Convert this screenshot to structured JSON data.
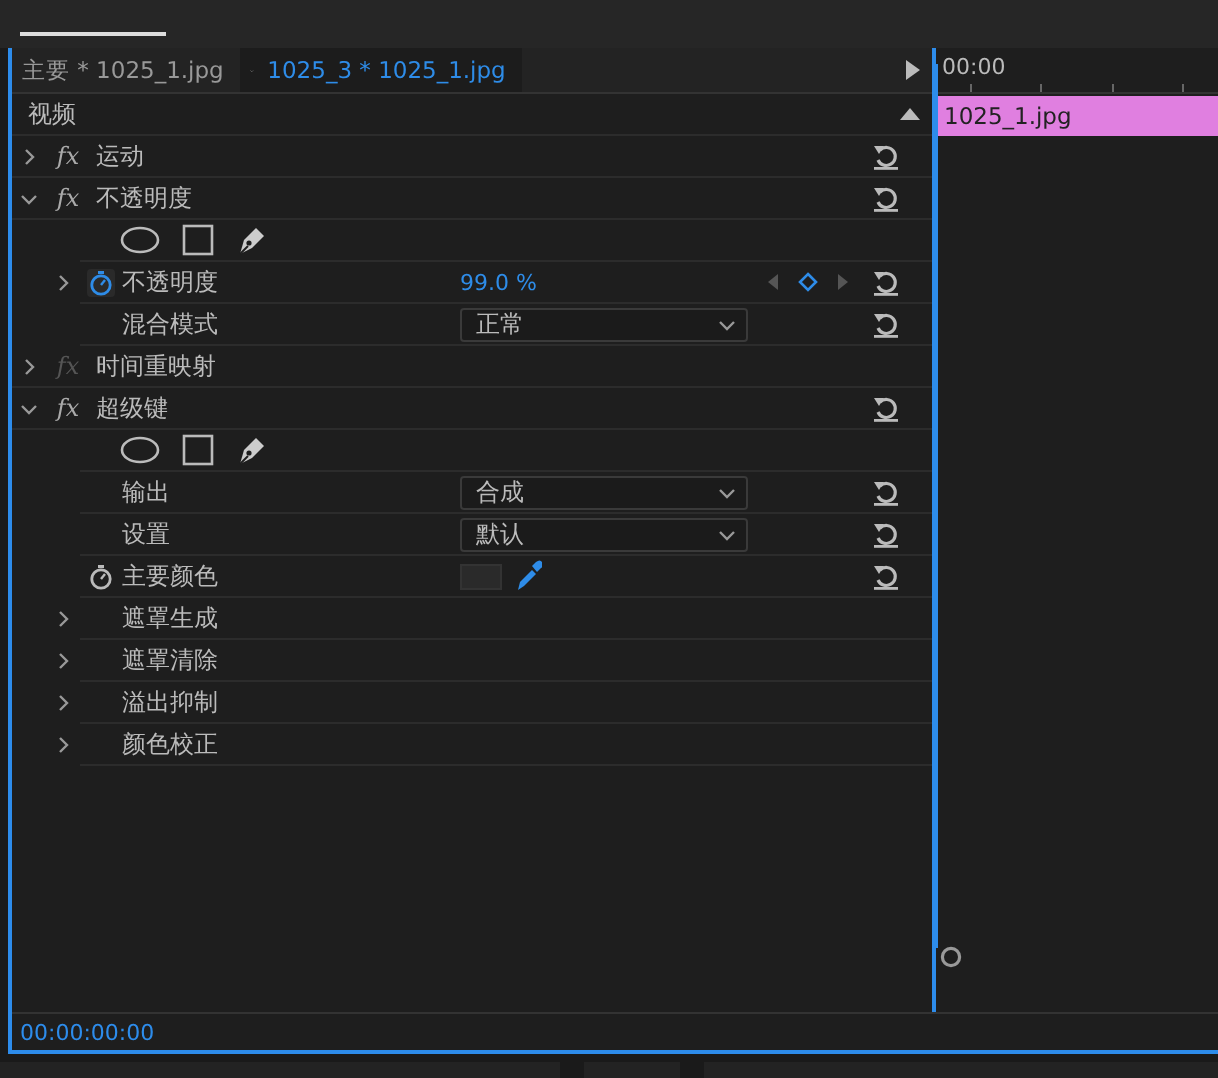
{
  "clip_tabs": [
    {
      "label": "主要 * 1025_1.jpg",
      "selected": false
    },
    {
      "label": "1025_3 * 1025_1.jpg",
      "selected": true
    }
  ],
  "section": {
    "label": "视频",
    "collapsed": false
  },
  "effects": [
    {
      "kind": "effect",
      "badge": "fx",
      "name": "运动",
      "expanded": false,
      "fx_enabled": true,
      "reset": true
    },
    {
      "kind": "effect",
      "badge": "fx",
      "name": "不透明度",
      "expanded": true,
      "fx_enabled": true,
      "reset": true,
      "children": [
        {
          "kind": "mask_tools"
        },
        {
          "kind": "value",
          "name": "不透明度",
          "value": "99.0 %",
          "expandable": true,
          "animated": true,
          "keyframes": true,
          "reset": true
        },
        {
          "kind": "dropdown",
          "name": "混合模式",
          "value": "正常",
          "reset": true
        }
      ]
    },
    {
      "kind": "effect",
      "badge": "fx",
      "name": "时间重映射",
      "expanded": false,
      "fx_enabled": false,
      "reset": false
    },
    {
      "kind": "effect",
      "badge": "fx",
      "name": "超级键",
      "expanded": true,
      "fx_enabled": true,
      "reset": true,
      "children": [
        {
          "kind": "mask_tools"
        },
        {
          "kind": "dropdown",
          "name": "输出",
          "value": "合成",
          "reset": true
        },
        {
          "kind": "dropdown",
          "name": "设置",
          "value": "默认",
          "reset": true
        },
        {
          "kind": "color",
          "name": "主要颜色",
          "animated": false,
          "reset": true
        },
        {
          "kind": "group",
          "name": "遮罩生成",
          "expanded": false
        },
        {
          "kind": "group",
          "name": "遮罩清除",
          "expanded": false
        },
        {
          "kind": "group",
          "name": "溢出抑制",
          "expanded": false
        },
        {
          "kind": "group",
          "name": "颜色校正",
          "expanded": false
        }
      ]
    }
  ],
  "timeline": {
    "time": "00:00",
    "clip": "1025_1.jpg"
  },
  "timecode": "00:00:00:00"
}
